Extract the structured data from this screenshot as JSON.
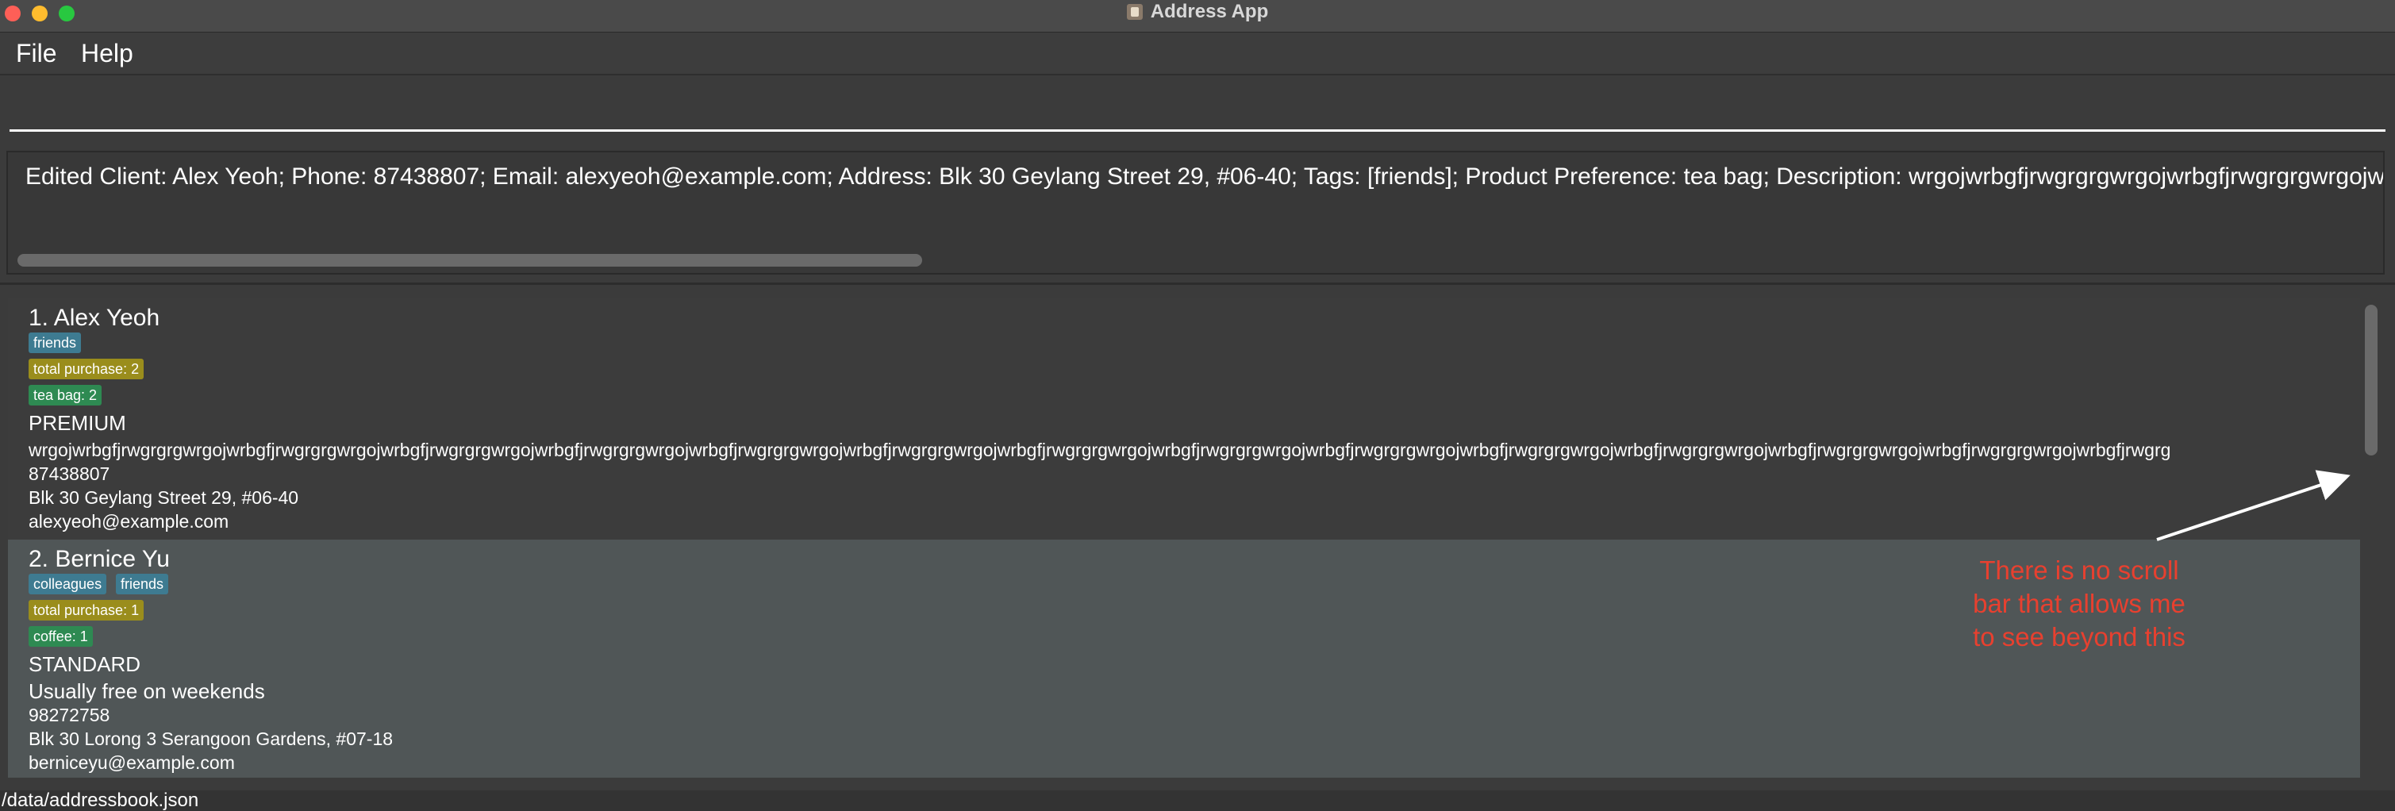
{
  "window": {
    "title": "Address App"
  },
  "menu": {
    "file_label": "File",
    "help_label": "Help"
  },
  "command": {
    "value": ""
  },
  "result": {
    "text": "Edited Client: Alex Yeoh; Phone: 87438807; Email: alexyeoh@example.com; Address: Blk 30 Geylang Street 29, #06-40; Tags: [friends]; Product Preference: tea bag; Description: wrgojwrbgfjrwgrgrgwrgojwrbgfjrwgrgrgwrgojwrbgfjrwgrgrgwrgojwrbgfjrwgrgrg"
  },
  "clients": [
    {
      "index_name": "1. Alex Yeoh",
      "tags": [
        "friends"
      ],
      "purchase": "total purchase: 2",
      "product": "tea bag: 2",
      "tier": "PREMIUM",
      "description": "wrgojwrbgfjrwgrgrgwrgojwrbgfjrwgrgrgwrgojwrbgfjrwgrgrgwrgojwrbgfjrwgrgrgwrgojwrbgfjrwgrgrgwrgojwrbgfjrwgrgrgwrgojwrbgfjrwgrgrgwrgojwrbgfjrwgrgrgwrgojwrbgfjrwgrgrgwrgojwrbgfjrwgrgrgwrgojwrbgfjrwgrgrgwrgojwrbgfjrwgrgrgwrgojwrbgfjrwgrgrgwrgojwrbgfjrwgrg",
      "phone": "87438807",
      "address": "Blk 30 Geylang Street 29, #06-40",
      "email": "alexyeoh@example.com"
    },
    {
      "index_name": "2. Bernice Yu",
      "tags": [
        "colleagues",
        "friends"
      ],
      "purchase": "total purchase: 1",
      "product": "coffee: 1",
      "tier": "STANDARD",
      "description": "Usually free on weekends",
      "phone": "98272758",
      "address": "Blk 30 Lorong 3 Serangoon Gardens, #07-18",
      "email": "berniceyu@example.com"
    }
  ],
  "annotation": {
    "line1": "There is no scroll",
    "line2": "bar that allows me",
    "line3": "to see beyond this",
    "color": "#e8402f"
  },
  "status": {
    "path": "/data/addressbook.json"
  }
}
